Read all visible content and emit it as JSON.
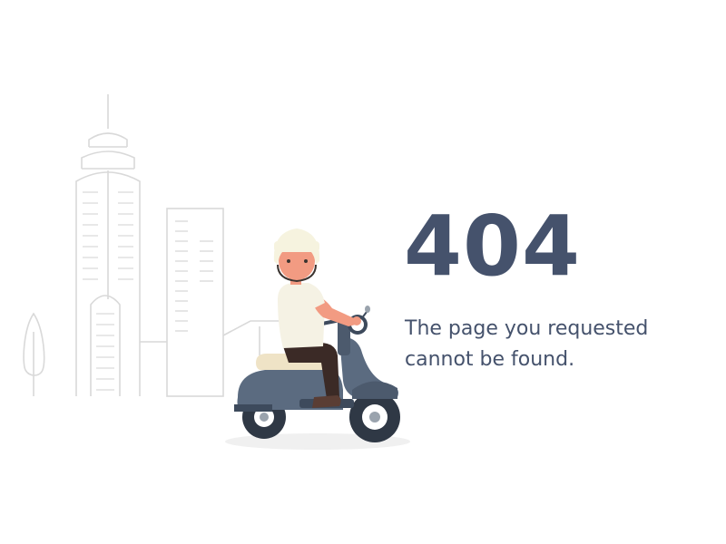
{
  "error": {
    "code": "404",
    "message_line1": "The page you requested",
    "message_line2": "cannot be found."
  },
  "colors": {
    "text": "#45526c",
    "line_art": "#d9d9d9",
    "scooter_body": "#5b6b80",
    "scooter_dark": "#3d4a5c",
    "helmet": "#f6f3df",
    "skin": "#f29b82",
    "shirt": "#f5f2e4",
    "pants": "#3b2a26",
    "seat": "#efe3c6"
  },
  "illustration": {
    "icons": [
      "city-skyline-icon",
      "tree-icon",
      "scooter-rider-icon"
    ]
  }
}
